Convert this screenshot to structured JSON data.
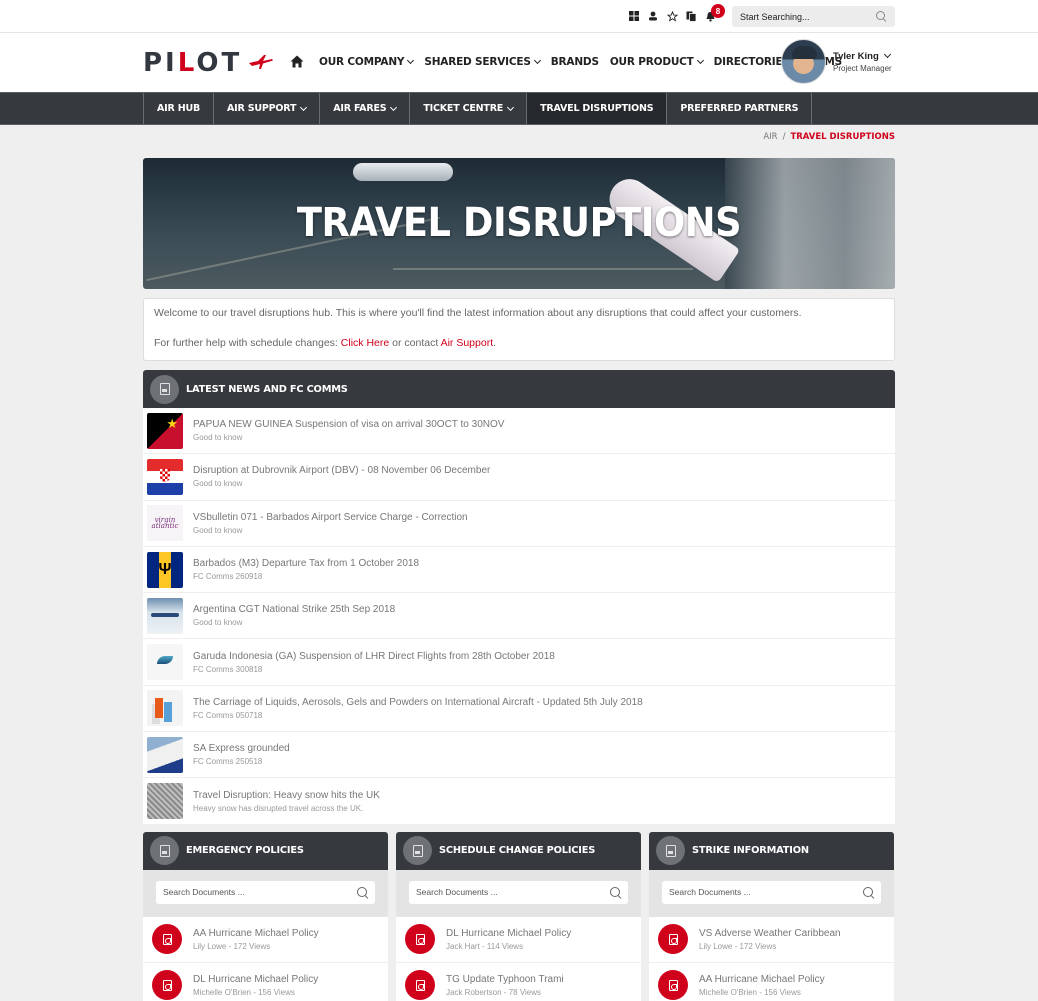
{
  "topbar": {
    "icons": [
      "windows-icon",
      "user-icon",
      "star-icon",
      "documents-icon",
      "bell-icon"
    ],
    "notification_count": "8",
    "search_placeholder": "Start Searching..."
  },
  "header": {
    "logo": {
      "part1": "PI",
      "part2": "L",
      "part3": "OT"
    },
    "nav": [
      {
        "label": "OUR COMPANY",
        "dropdown": true
      },
      {
        "label": "SHARED SERVICES",
        "dropdown": true
      },
      {
        "label": "BRANDS",
        "dropdown": false
      },
      {
        "label": "OUR PRODUCT",
        "dropdown": true
      },
      {
        "label": "DIRECTORIES",
        "dropdown": false
      },
      {
        "label": "FORMS",
        "dropdown": false
      }
    ],
    "user": {
      "name": "Tyler King",
      "role": "Project Manager"
    }
  },
  "subnav": {
    "tabs": [
      {
        "label": "AIR HUB",
        "dropdown": false,
        "active": false
      },
      {
        "label": "AIR SUPPORT",
        "dropdown": true,
        "active": false
      },
      {
        "label": "AIR FARES",
        "dropdown": true,
        "active": false
      },
      {
        "label": "TICKET CENTRE",
        "dropdown": true,
        "active": false
      },
      {
        "label": "TRAVEL DISRUPTIONS",
        "dropdown": false,
        "active": true
      },
      {
        "label": "PREFERRED PARTNERS",
        "dropdown": false,
        "active": false
      }
    ]
  },
  "breadcrumb": {
    "parent": "AIR",
    "separator": "/",
    "current": "TRAVEL DISRUPTIONS"
  },
  "hero": {
    "title": "TRAVEL DISRUPTIONS"
  },
  "intro": {
    "line1": "Welcome to our travel disruptions hub. This is where you'll find the latest information about any disruptions that could affect your customers.",
    "line2_prefix": "For further help with schedule changes: ",
    "link1": "Click Here",
    "line2_middle": " or contact ",
    "link2": "Air Support",
    "line2_suffix": "."
  },
  "news": {
    "title": "LATEST NEWS AND FC COMMS",
    "items": [
      {
        "title": "PAPUA NEW GUINEA Suspension of visa on arrival 30OCT to 30NOV",
        "sub": "Good to know",
        "thumb": "png-flag"
      },
      {
        "title": "Disruption at Dubrovnik Airport (DBV) - 08 November 06 December",
        "sub": "Good to know",
        "thumb": "croatia-flag"
      },
      {
        "title": "VSbulletin 071 - Barbados Airport Service Charge - Correction",
        "sub": "Good to know",
        "thumb": "virgin-atlantic-logo"
      },
      {
        "title": "Barbados (M3) Departure Tax from 1 October 2018",
        "sub": "FC Comms 260918",
        "thumb": "barbados-flag"
      },
      {
        "title": "Argentina CGT National Strike 25th Sep 2018",
        "sub": "Good to know",
        "thumb": "airplane-photo"
      },
      {
        "title": "Garuda Indonesia (GA) Suspension of LHR Direct Flights from 28th October 2018",
        "sub": "FC Comms 300818",
        "thumb": "garuda-logo"
      },
      {
        "title": "The Carriage of Liquids, Aerosols, Gels and Powders on International Aircraft - Updated 5th July 2018",
        "sub": "FC Comms 050718",
        "thumb": "liquids-photo"
      },
      {
        "title": "SA Express grounded",
        "sub": "FC Comms 250518",
        "thumb": "sa-express-photo"
      },
      {
        "title": "Travel Disruption: Heavy snow hits the UK",
        "sub": "Heavy snow has disrupted travel across the UK.",
        "thumb": "snow-photo"
      }
    ]
  },
  "cards": [
    {
      "title": "EMERGENCY POLICIES",
      "search_placeholder": "Search Documents ...",
      "docs": [
        {
          "title": "AA Hurricane Michael Policy",
          "sub": "Lily Lowe - 172 Views"
        },
        {
          "title": "DL Hurricane Michael Policy",
          "sub": "Michelle O'Brien - 156 Views"
        }
      ]
    },
    {
      "title": "SCHEDULE CHANGE POLICIES",
      "search_placeholder": "Search Documents ...",
      "docs": [
        {
          "title": "DL Hurricane Michael Policy",
          "sub": "Jack Hart - 114 Views"
        },
        {
          "title": "TG Update Typhoon Trami",
          "sub": "Jack Robertson - 78 Views"
        }
      ]
    },
    {
      "title": "STRIKE INFORMATION",
      "search_placeholder": "Search Documents ...",
      "docs": [
        {
          "title": "VS Adverse Weather Caribbean",
          "sub": "Lily Lowe - 172 Views"
        },
        {
          "title": "AA Hurricane Michael Policy",
          "sub": "Michelle O'Brien - 156 Views"
        }
      ]
    }
  ],
  "colors": {
    "brand_red": "#d0021b",
    "dark_bar": "#363a3f",
    "active_tab": "#25282c",
    "page_bg": "#efefef"
  }
}
